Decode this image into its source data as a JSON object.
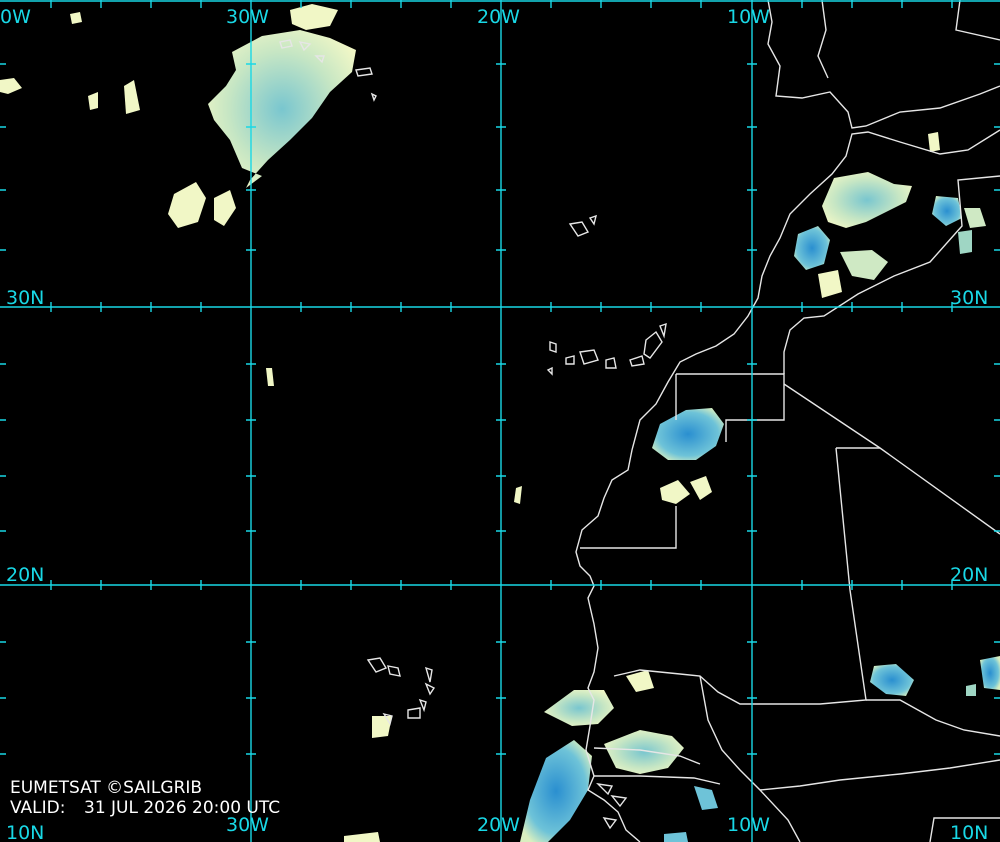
{
  "map": {
    "source": "EUMETSAT ©SAILGRIB",
    "valid_prefix": "VALID:",
    "valid_time": "31 JUL 2026 20:00 UTC"
  },
  "grid": {
    "lon_labels_top": [
      "30W",
      "20W",
      "10W"
    ],
    "lon_labels_bottom": [
      "30W",
      "20W",
      "10W"
    ],
    "lat_labels_left": [
      "30N",
      "20N"
    ],
    "lat_labels_right": [
      "30N",
      "20N"
    ],
    "corner_labels": [
      "0W",
      "10N",
      "10N"
    ],
    "line_color": "#19d8e6"
  },
  "colors": {
    "background": "#000000",
    "coastline": "#e6e6e6",
    "cloud_light": "#f2f7c6",
    "cloud_mid": "#9fd6c4",
    "cloud_dense": "#3aa0d6"
  }
}
